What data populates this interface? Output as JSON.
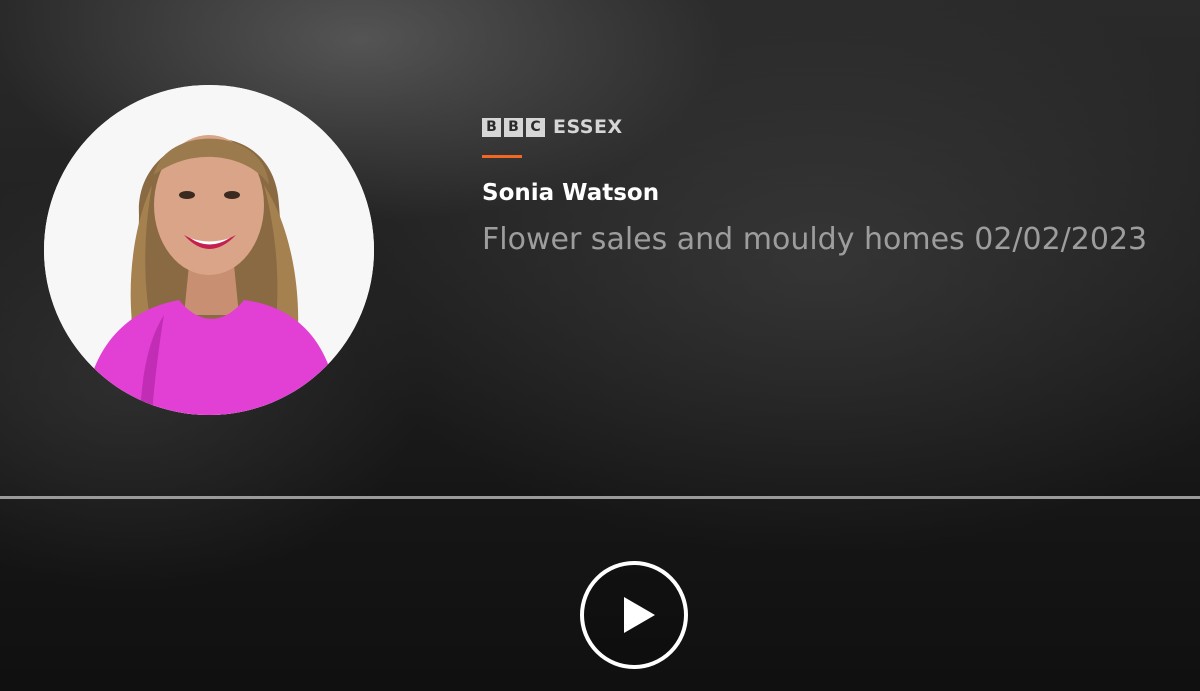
{
  "brand": {
    "letters": [
      "B",
      "B",
      "C"
    ],
    "station": "ESSEX",
    "accent_color": "#f26722"
  },
  "presenter": {
    "name": "Sonia Watson",
    "photo": "presenter-photo"
  },
  "episode": {
    "title": "Flower sales and mouldy homes 02/02/2023"
  },
  "progress": {
    "fraction": 0
  },
  "controls": {
    "play_icon": "play-icon"
  }
}
